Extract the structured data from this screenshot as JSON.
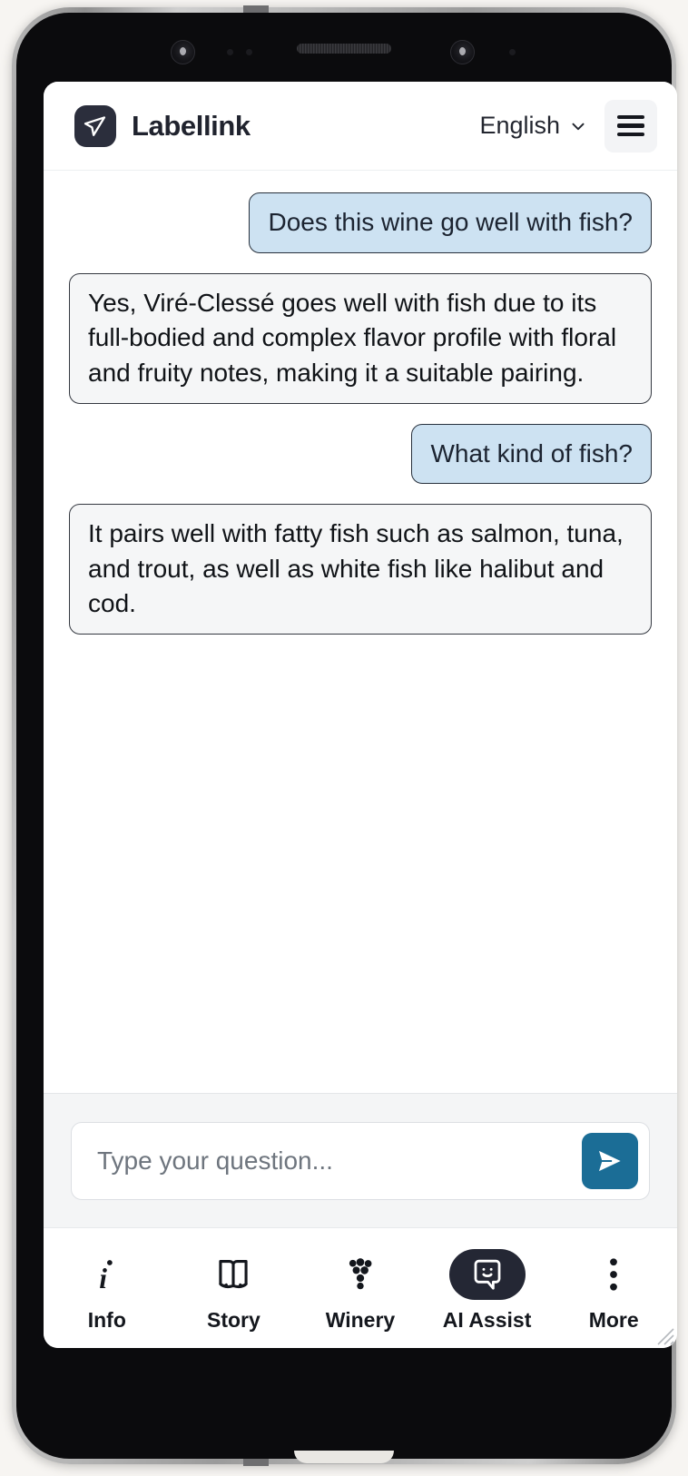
{
  "header": {
    "brand_name": "Labellink",
    "logo_icon": "navigation-arrow-icon",
    "language": "English",
    "language_chevron_icon": "chevron-down-icon",
    "menu_icon": "hamburger-menu-icon"
  },
  "chat": {
    "messages": [
      {
        "role": "user",
        "text": "Does this wine go well with fish?"
      },
      {
        "role": "assistant",
        "text": "Yes, Viré-Clessé goes well with fish due to its full-bodied and complex flavor profile with floral and fruity notes, making it a suitable pairing."
      },
      {
        "role": "user",
        "text": "What kind of fish?"
      },
      {
        "role": "assistant",
        "text": "It pairs well with fatty fish such as salmon, tuna, and trout, as well as white fish like halibut and cod."
      }
    ]
  },
  "composer": {
    "placeholder": "Type your question...",
    "value": "",
    "send_icon": "send-paper-plane-icon",
    "send_button_color": "#1b6d96"
  },
  "bottom_nav": {
    "items": [
      {
        "label": "Info",
        "icon": "info-italic-i-icon",
        "active": false
      },
      {
        "label": "Story",
        "icon": "open-book-icon",
        "active": false
      },
      {
        "label": "Winery",
        "icon": "grape-cluster-icon",
        "active": false
      },
      {
        "label": "AI Assist",
        "icon": "smiley-chat-bubble-icon",
        "active": true
      },
      {
        "label": "More",
        "icon": "three-dots-vertical-icon",
        "active": false
      }
    ],
    "active_pill_color": "#242734"
  },
  "theme": {
    "user_bubble_bg": "#cde2f2",
    "assistant_bubble_bg": "#f5f6f7",
    "brand_dark": "#2b2e3c",
    "page_bg": "#f7f5f2"
  }
}
